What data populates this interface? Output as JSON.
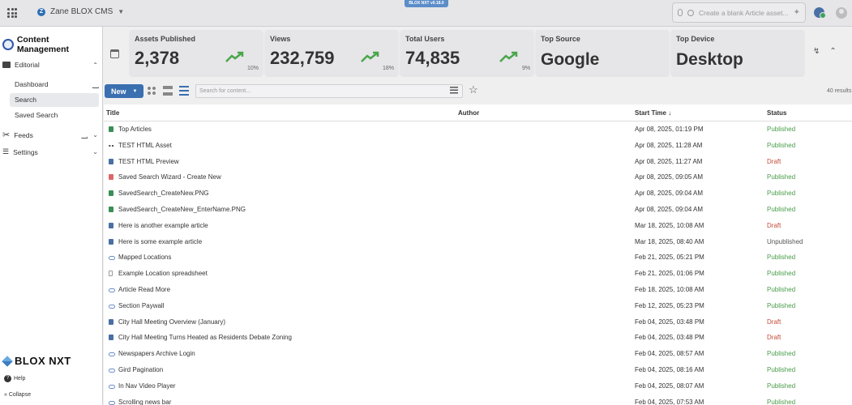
{
  "topbar": {
    "site_name": "Zane BLOX CMS",
    "version": "BLOX NXT v0.18.0",
    "search_placeholder": "Create a blank Article asset..."
  },
  "sidebar": {
    "title": "Content Management",
    "sections": [
      {
        "label": "Editorial",
        "items": [
          "Dashboard",
          "Search",
          "Saved Search"
        ]
      },
      {
        "label": "Feeds"
      },
      {
        "label": "Settings"
      }
    ],
    "brand": "BLOX NXT",
    "help": "Help",
    "collapse": "Collapse"
  },
  "stats": [
    {
      "label": "Assets Published",
      "value": "2,378",
      "pct": "10%"
    },
    {
      "label": "Views",
      "value": "232,759",
      "pct": "18%"
    },
    {
      "label": "Total Users",
      "value": "74,835",
      "pct": "9%"
    },
    {
      "label": "Top Source",
      "value": "Google"
    },
    {
      "label": "Top Device",
      "value": "Desktop"
    }
  ],
  "toolbar": {
    "new_label": "New",
    "search_placeholder": "Search for content...",
    "results": "40 results"
  },
  "table": {
    "headers": {
      "title": "Title",
      "author": "Author",
      "start_time": "Start Time",
      "status": "Status"
    },
    "rows": [
      {
        "icon": "image",
        "title": "Top Articles",
        "time": "Apr 08, 2025, 01:19 PM",
        "status": "Published"
      },
      {
        "icon": "html",
        "title": "TEST HTML Asset",
        "time": "Apr 08, 2025, 11:28 AM",
        "status": "Published"
      },
      {
        "icon": "article",
        "title": "TEST HTML Preview",
        "time": "Apr 08, 2025, 11:27 AM",
        "status": "Draft"
      },
      {
        "icon": "search",
        "title": "Saved Search Wizard - Create New",
        "time": "Apr 08, 2025, 09:05 AM",
        "status": "Published"
      },
      {
        "icon": "image",
        "title": "SavedSearch_CreateNew.PNG",
        "time": "Apr 08, 2025, 09:04 AM",
        "status": "Published"
      },
      {
        "icon": "image",
        "title": "SavedSearch_CreateNew_EnterName.PNG",
        "time": "Apr 08, 2025, 09:04 AM",
        "status": "Published"
      },
      {
        "icon": "article",
        "title": "Here is another example article",
        "time": "Mar 18, 2025, 10:08 AM",
        "status": "Draft"
      },
      {
        "icon": "article",
        "title": "Here is some example article",
        "time": "Mar 18, 2025, 08:40 AM",
        "status": "Unpublished"
      },
      {
        "icon": "link",
        "title": "Mapped Locations",
        "time": "Feb 21, 2025, 05:21 PM",
        "status": "Published"
      },
      {
        "icon": "file",
        "title": "Example Location spreadsheet",
        "time": "Feb 21, 2025, 01:06 PM",
        "status": "Published"
      },
      {
        "icon": "link",
        "title": "Article Read More",
        "time": "Feb 18, 2025, 10:08 AM",
        "status": "Published"
      },
      {
        "icon": "link",
        "title": "Section Paywall",
        "time": "Feb 12, 2025, 05:23 PM",
        "status": "Published"
      },
      {
        "icon": "article",
        "title": "City Hall Meeting Overview (January)",
        "time": "Feb 04, 2025, 03:48 PM",
        "status": "Draft"
      },
      {
        "icon": "article",
        "title": "City Hall Meeting Turns Heated as Residents Debate Zoning",
        "time": "Feb 04, 2025, 03:48 PM",
        "status": "Draft"
      },
      {
        "icon": "link",
        "title": "Newspapers Archive Login",
        "time": "Feb 04, 2025, 08:57 AM",
        "status": "Published"
      },
      {
        "icon": "link",
        "title": "Gird Pagination",
        "time": "Feb 04, 2025, 08:16 AM",
        "status": "Published"
      },
      {
        "icon": "link",
        "title": "In Nav Video Player",
        "time": "Feb 04, 2025, 08:07 AM",
        "status": "Published"
      },
      {
        "icon": "link",
        "title": "Scrolling news bar",
        "time": "Feb 04, 2025, 07:53 AM",
        "status": "Published"
      }
    ]
  }
}
